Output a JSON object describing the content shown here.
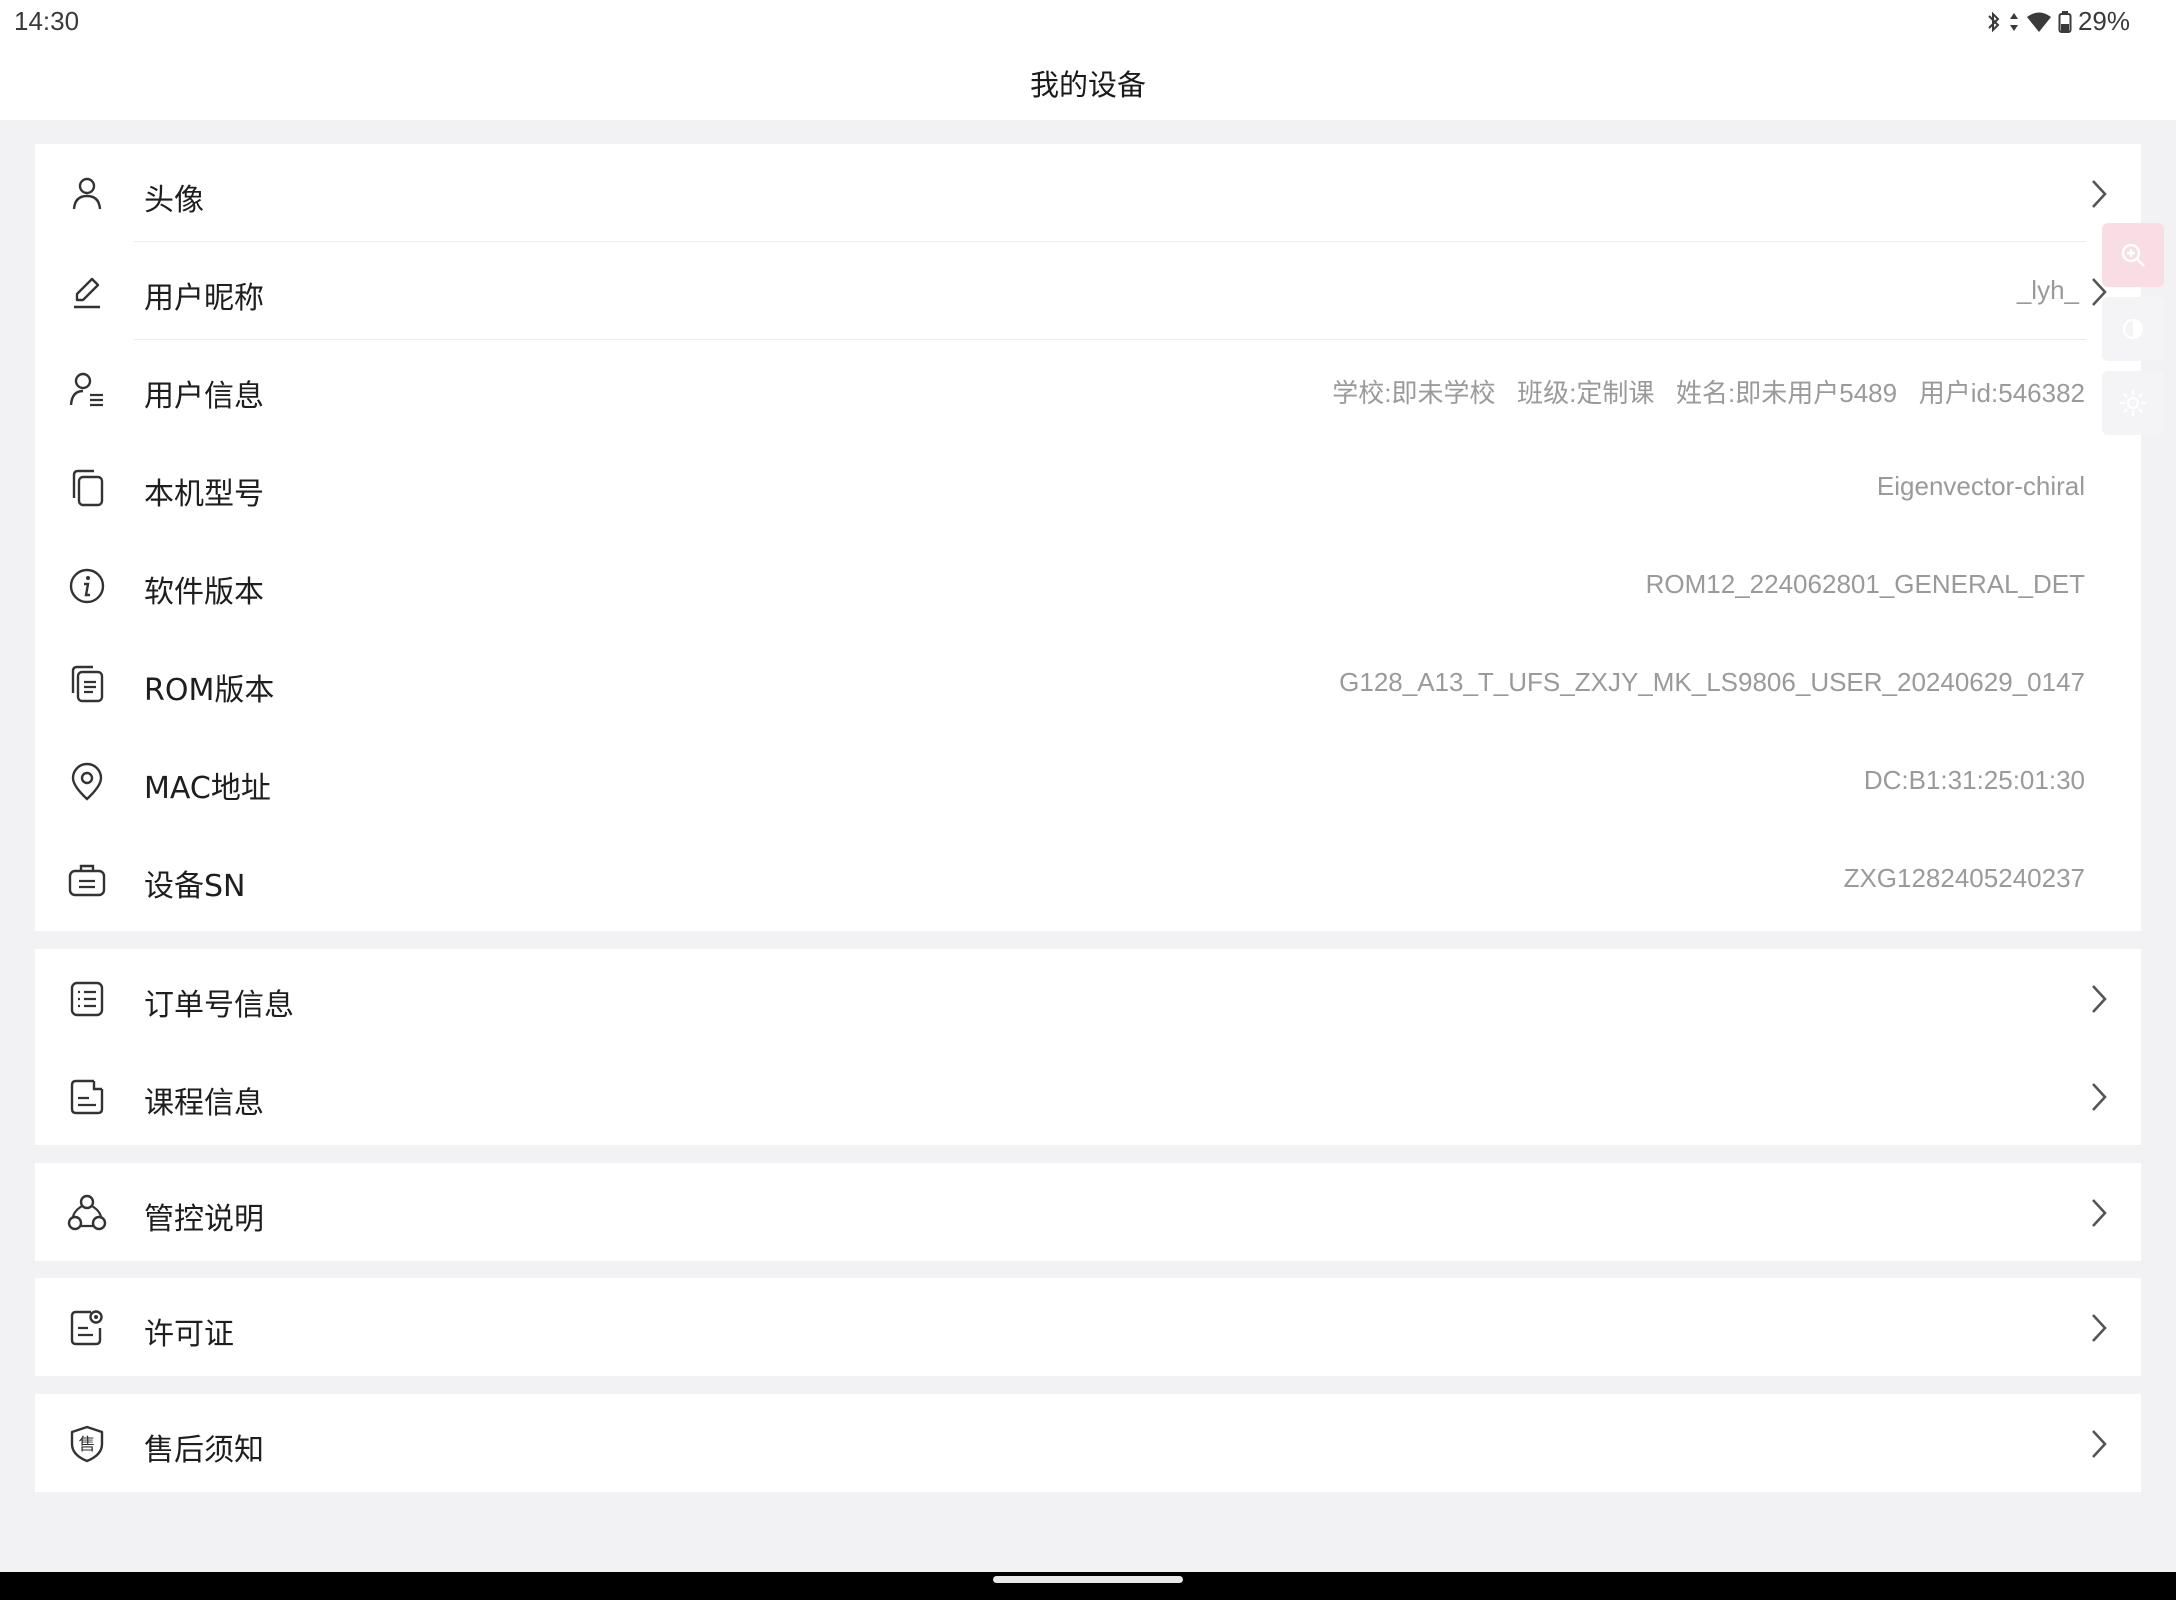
{
  "status_bar": {
    "time": "14:30",
    "battery": "29%",
    "icons": [
      "bluetooth-icon",
      "data-arrows-icon",
      "wifi-icon",
      "battery-icon"
    ]
  },
  "header": {
    "title": "我的设备"
  },
  "device_info": [
    {
      "label": "头像",
      "value": "",
      "icon": "person-icon",
      "chevron": true
    },
    {
      "label": "用户昵称",
      "value": "_lyh_",
      "icon": "edit-pen-icon",
      "chevron": true
    },
    {
      "label": "用户信息",
      "value": "学校:即未学校   班级:定制课   姓名:即未用户5489   用户id:546382",
      "icon": "user-list-icon",
      "chevron": false
    },
    {
      "label": "本机型号",
      "value": "Eigenvector-chiral",
      "icon": "device-copy-icon",
      "chevron": false
    },
    {
      "label": "软件版本",
      "value": "ROM12_224062801_GENERAL_DET",
      "icon": "info-circle-icon",
      "chevron": false
    },
    {
      "label": "ROM版本",
      "value": "G128_A13_T_UFS_ZXJY_MK_LS9806_USER_20240629_0147",
      "icon": "document-copy-icon",
      "chevron": false
    },
    {
      "label": "MAC地址",
      "value": "DC:B1:31:25:01:30",
      "icon": "location-pin-icon",
      "chevron": false
    },
    {
      "label": "设备SN",
      "value": "ZXG1282405240237",
      "icon": "id-card-icon",
      "chevron": false
    }
  ],
  "order_course": [
    {
      "label": "订单号信息",
      "icon": "list-icon"
    },
    {
      "label": "课程信息",
      "icon": "course-note-icon"
    }
  ],
  "control": {
    "label": "管控说明",
    "icon": "network-group-icon"
  },
  "license": {
    "label": "许可证",
    "icon": "certificate-icon"
  },
  "after_sales": {
    "label": "售后须知",
    "icon": "shield-sale-icon",
    "badge_char": "售"
  },
  "floating_tools": [
    "zoom-in-icon",
    "contrast-icon",
    "brightness-icon"
  ],
  "colors": {
    "background": "#f2f2f4",
    "card": "#ffffff",
    "value_text": "#9a9a9a",
    "accent_pink": "#f8dde3"
  }
}
